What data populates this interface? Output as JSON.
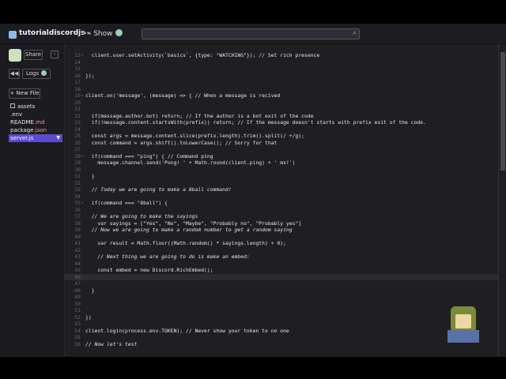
{
  "header": {
    "project_name": "tutorialdiscordjs",
    "show_label": "Show",
    "search_placeholder": ""
  },
  "sidebar": {
    "share_label": "Share",
    "logs_label": "Logs",
    "new_file_label": "+ New File",
    "files": [
      {
        "name": "assets",
        "ext": "",
        "active": false
      },
      {
        "name": ".env",
        "ext": "",
        "active": false
      },
      {
        "name": "README",
        "ext": ".md",
        "active": false
      },
      {
        "name": "package",
        "ext": ".json",
        "active": false
      },
      {
        "name": "server",
        "ext": ".js",
        "active": true
      }
    ]
  },
  "editor": {
    "lines": [
      {
        "n": "13",
        "text": "  client.user.setActivity(`basics`, {type: \"WATCHING\"}); // Set rich presence",
        "fold": "▸"
      },
      {
        "n": "14",
        "text": ""
      },
      {
        "n": "15",
        "text": ""
      },
      {
        "n": "16",
        "text": "});"
      },
      {
        "n": "17",
        "text": ""
      },
      {
        "n": "18",
        "text": ""
      },
      {
        "n": "19",
        "text": "client.on('message', (message) => { // When a message is recived",
        "fold": "▸"
      },
      {
        "n": "20",
        "text": ""
      },
      {
        "n": "21",
        "text": ""
      },
      {
        "n": "22",
        "text": "  if(message.author.bot) return; // If the author is a bot exit of the code"
      },
      {
        "n": "23",
        "text": "  if(!message.content.startsWith(prefix)) return; // If the message doesn't starts with prefix exit of the code."
      },
      {
        "n": "24",
        "text": ""
      },
      {
        "n": "25",
        "text": "  const args = message.content.slice(prefix.length).trim().split(/ +/g);"
      },
      {
        "n": "26",
        "text": "  const command = args.shift().toLowerCase(); // Sorry for that"
      },
      {
        "n": "27",
        "text": ""
      },
      {
        "n": "28",
        "text": "  if(command === \"ping\") { // Command ping",
        "fold": "▸"
      },
      {
        "n": "29",
        "text": "    message.channel.send('Pong! ' + Math.round(client.ping) + ' ms!')"
      },
      {
        "n": "30",
        "text": ""
      },
      {
        "n": "31",
        "text": "  }"
      },
      {
        "n": "32",
        "text": ""
      },
      {
        "n": "33",
        "text": "  // Today we are going to make a 8ball command!"
      },
      {
        "n": "34",
        "text": ""
      },
      {
        "n": "35",
        "text": "  if(command === \"8ball\") {",
        "fold": "▸"
      },
      {
        "n": "36",
        "text": ""
      },
      {
        "n": "37",
        "text": "  // We are going to make the sayings"
      },
      {
        "n": "38",
        "text": "    var sayings = [\"Yes\", \"No\", \"Maybe\", \"Probably no\", \"Probably yes\"]"
      },
      {
        "n": "39",
        "text": "  // Now we are going to make a random number to get a random saying"
      },
      {
        "n": "40",
        "text": ""
      },
      {
        "n": "41",
        "text": "    var result = Math.floor((Math.random() * sayings.length) + 0);"
      },
      {
        "n": "42",
        "text": ""
      },
      {
        "n": "43",
        "text": "    // Next thing we are going to do is make an embed:"
      },
      {
        "n": "44",
        "text": ""
      },
      {
        "n": "45",
        "text": "    const embed = new Discord.RichEmbed();"
      },
      {
        "n": "46",
        "text": "",
        "current": true
      },
      {
        "n": "47",
        "text": ""
      },
      {
        "n": "48",
        "text": "  }"
      },
      {
        "n": "49",
        "text": ""
      },
      {
        "n": "50",
        "text": ""
      },
      {
        "n": "51",
        "text": ""
      },
      {
        "n": "52",
        "text": "})"
      },
      {
        "n": "53",
        "text": ""
      },
      {
        "n": "54",
        "text": "client.login(process.env.TOKEN); // Never show your token to no one"
      },
      {
        "n": "55",
        "text": ""
      },
      {
        "n": "56",
        "text": "// Now let's test"
      }
    ]
  }
}
